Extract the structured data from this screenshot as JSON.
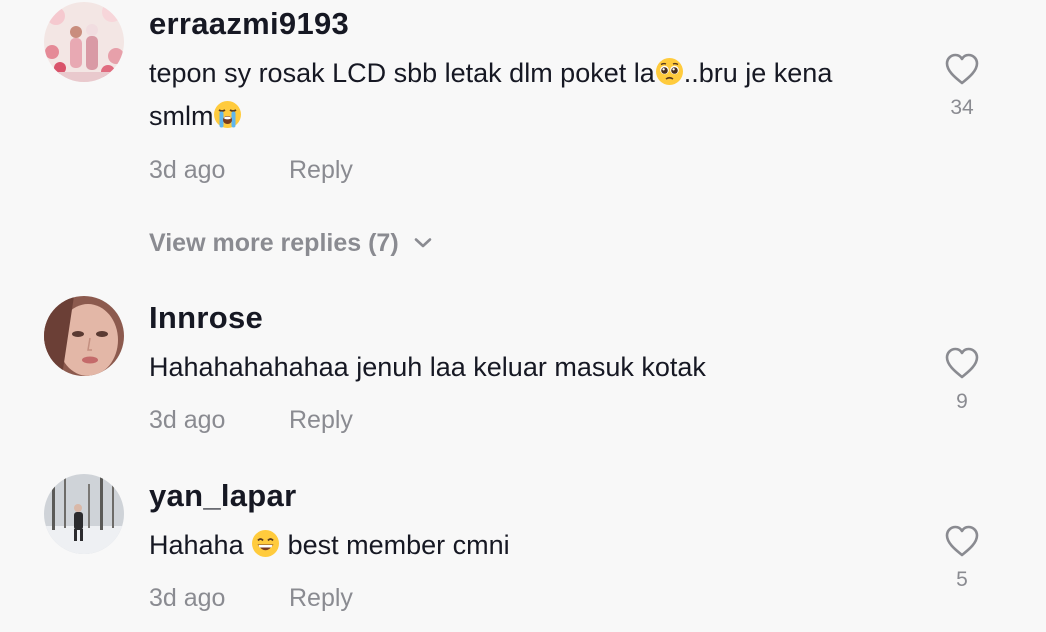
{
  "comments": [
    {
      "username": "erraazmi9193",
      "text_before": "tepon sy rosak LCD sbb letak dlm poket la",
      "emoji_1": "pleading-face-emoji",
      "text_middle": "..bru je kena smlm",
      "emoji_2": "loudly-crying-face-emoji",
      "time": "3d ago",
      "reply_label": "Reply",
      "likes": "34",
      "view_more_label": "View more replies (7)"
    },
    {
      "username": "Innrose",
      "text": "Hahahahahahaa jenuh laa keluar masuk kotak",
      "time": "3d ago",
      "reply_label": "Reply",
      "likes": "9"
    },
    {
      "username": "yan_lapar",
      "text_before": "Hahaha ",
      "emoji_1": "grinning-face-emoji",
      "text_after": " best member cmni",
      "time": "3d ago",
      "reply_label": "Reply",
      "likes": "5"
    }
  ],
  "colors": {
    "background": "#f8f8f8",
    "primary_text": "#161823",
    "secondary_text": "#8a8b91"
  }
}
